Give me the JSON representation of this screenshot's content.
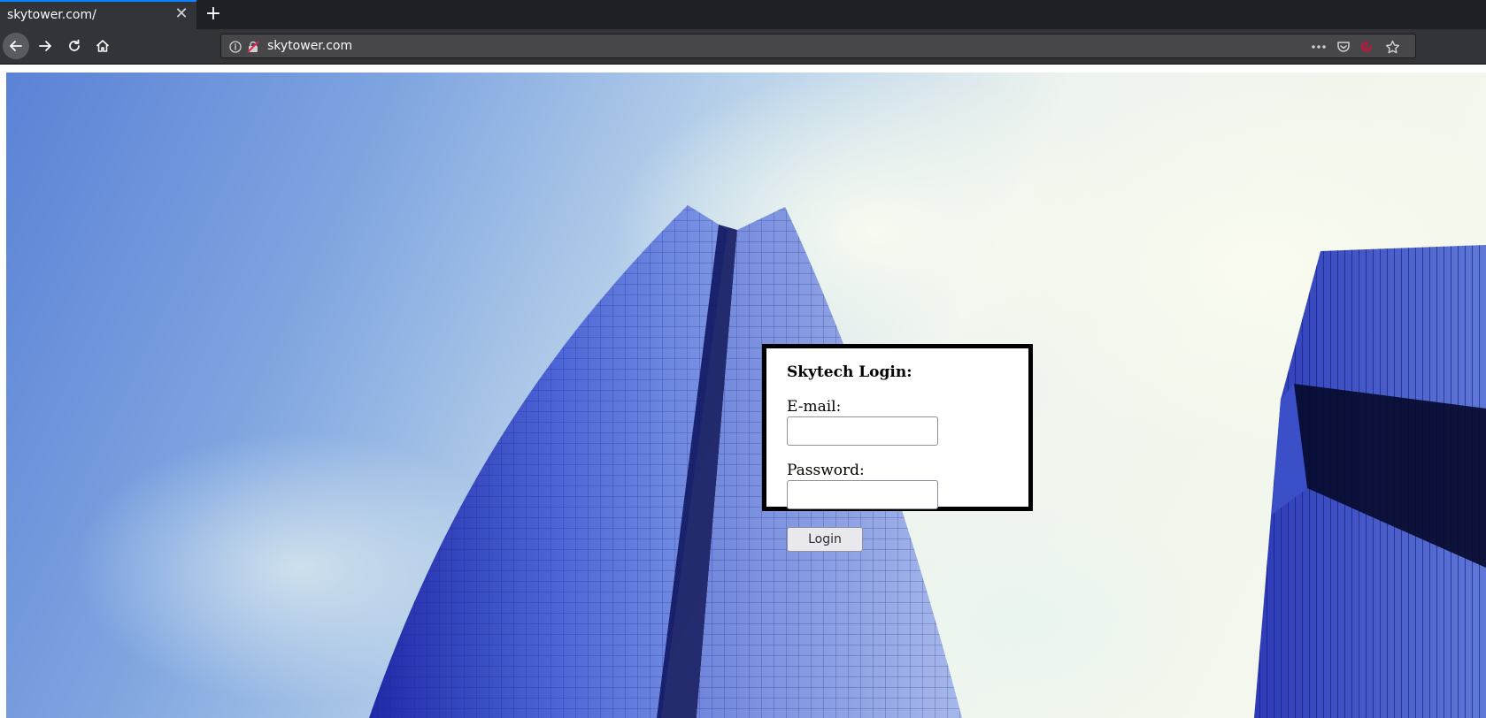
{
  "browser": {
    "tab_title": "skytower.com/",
    "tab_close_icon": "close-icon",
    "new_tab_icon": "plus-icon",
    "nav": {
      "back_icon": "back-arrow-icon",
      "forward_icon": "forward-arrow-icon",
      "reload_icon": "reload-icon",
      "home_icon": "home-icon"
    },
    "url": "skytower.com",
    "url_icons": [
      "info-icon",
      "insecure-lock-icon"
    ],
    "actions": [
      "more-icon",
      "pocket-icon",
      "extension-icon",
      "bookmark-star-icon"
    ],
    "accent": "#0a84ff"
  },
  "page": {
    "background_image": "skyscrapers-blue-sky",
    "login": {
      "title": "Skytech Login:",
      "email_label": "E-mail:",
      "email_value": "",
      "password_label": "Password:",
      "password_value": "",
      "button_label": "Login"
    }
  }
}
